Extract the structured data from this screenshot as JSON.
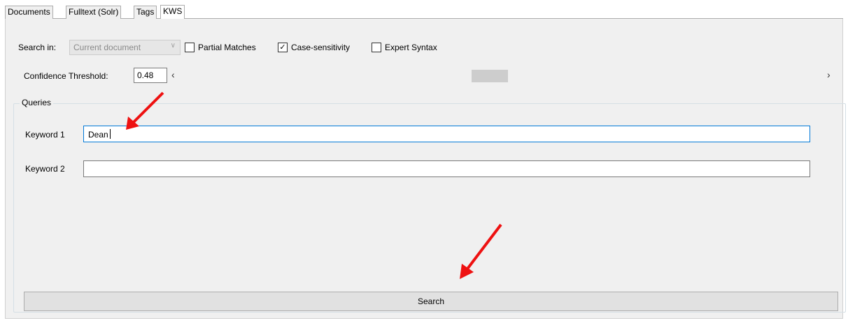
{
  "tabs": [
    {
      "label": "Documents"
    },
    {
      "label": "Fulltext (Solr)"
    },
    {
      "label": "Tags"
    },
    {
      "label": "KWS"
    }
  ],
  "options": {
    "search_in_label": "Search in:",
    "search_in_value": "Current document",
    "partial_matches_label": "Partial Matches",
    "partial_matches_checked": false,
    "case_sensitivity_label": "Case-sensitivity",
    "case_sensitivity_checked": true,
    "expert_syntax_label": "Expert Syntax",
    "expert_syntax_checked": false
  },
  "threshold": {
    "label": "Confidence Threshold:",
    "value": "0.48"
  },
  "queries": {
    "group_label": "Queries",
    "keywords": [
      {
        "label": "Keyword 1",
        "value": "Dean"
      },
      {
        "label": "Keyword 2",
        "value": ""
      }
    ]
  },
  "search_button_label": "Search",
  "annotation_color": "#ee1111"
}
